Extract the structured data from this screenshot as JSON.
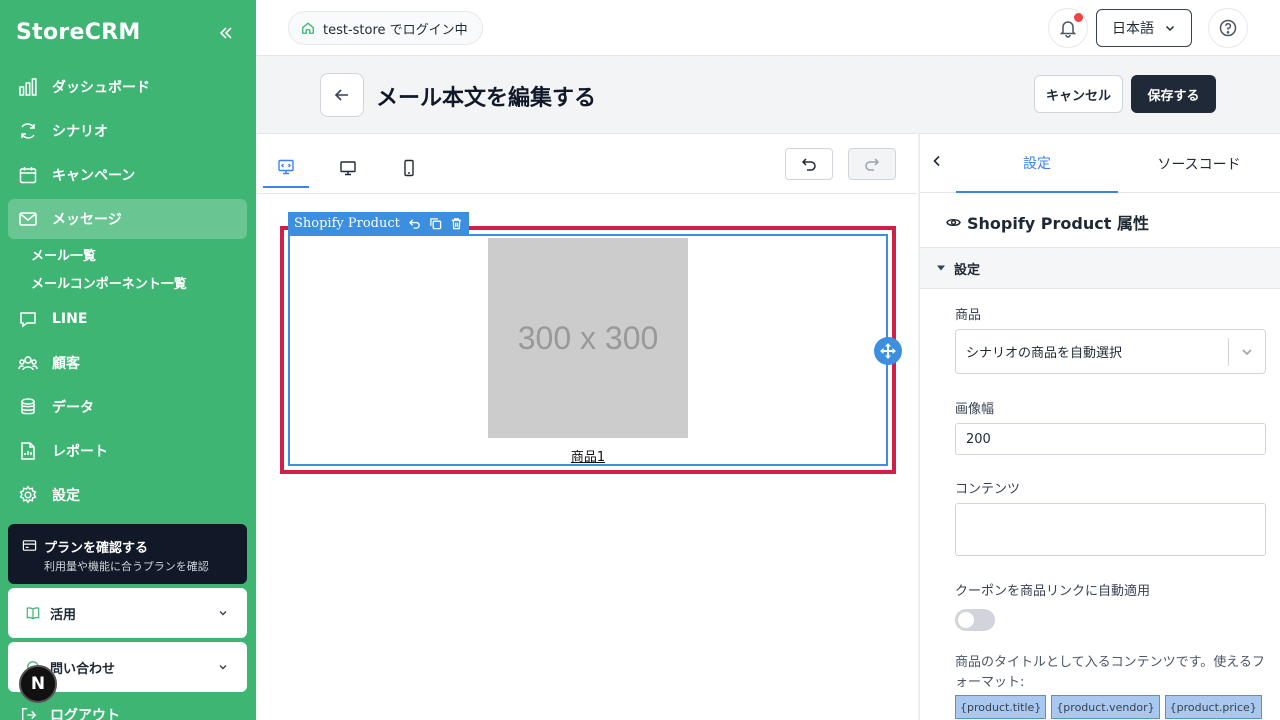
{
  "sidebar": {
    "brand": "StoreCRM",
    "nav": [
      {
        "label": "ダッシュボード",
        "icon": "chart-bars-icon"
      },
      {
        "label": "シナリオ",
        "icon": "refresh-icon"
      },
      {
        "label": "キャンペーン",
        "icon": "calendar-icon"
      },
      {
        "label": "メッセージ",
        "icon": "envelope-icon"
      },
      {
        "label": "LINE",
        "icon": "chat-icon"
      },
      {
        "label": "顧客",
        "icon": "users-icon"
      },
      {
        "label": "データ",
        "icon": "database-icon"
      },
      {
        "label": "レポート",
        "icon": "report-icon"
      },
      {
        "label": "設定",
        "icon": "gear-icon"
      }
    ],
    "sub_items": [
      "メール一覧",
      "メールコンポーネント一覧"
    ],
    "plan": {
      "title": "プランを確認する",
      "subtitle": "利用量や機能に合うプランを確認"
    },
    "accordions": [
      "活用",
      "問い合わせ"
    ],
    "logout": "ログアウト",
    "badge": "N"
  },
  "topbar": {
    "store_status": "test-store でログイン中",
    "language": "日本語"
  },
  "header": {
    "title": "メール本文を編集する",
    "cancel": "キャンセル",
    "save": "保存する"
  },
  "editor": {
    "component_name": "Shopify Product",
    "placeholder_text": "300 x 300",
    "product_link": "商品1"
  },
  "panel": {
    "tabs": [
      "設定",
      "ソースコード"
    ],
    "attr_title": "Shopify Product 属性",
    "section": "設定",
    "product_label": "商品",
    "product_value": "シナリオの商品を自動選択",
    "image_width_label": "画像幅",
    "image_width_value": "200",
    "content_label": "コンテンツ",
    "coupon_label": "クーポンを商品リンクに自動適用",
    "coupon_enabled": false,
    "help": "商品のタイトルとして入るコンテンツです。使えるフォーマット:",
    "tokens": [
      "{product.title}",
      "{product.vendor}",
      "{product.price}"
    ]
  },
  "colors": {
    "sidebar": "#3fb574",
    "accent": "#3b82f6",
    "selection": "#d11f4b"
  }
}
